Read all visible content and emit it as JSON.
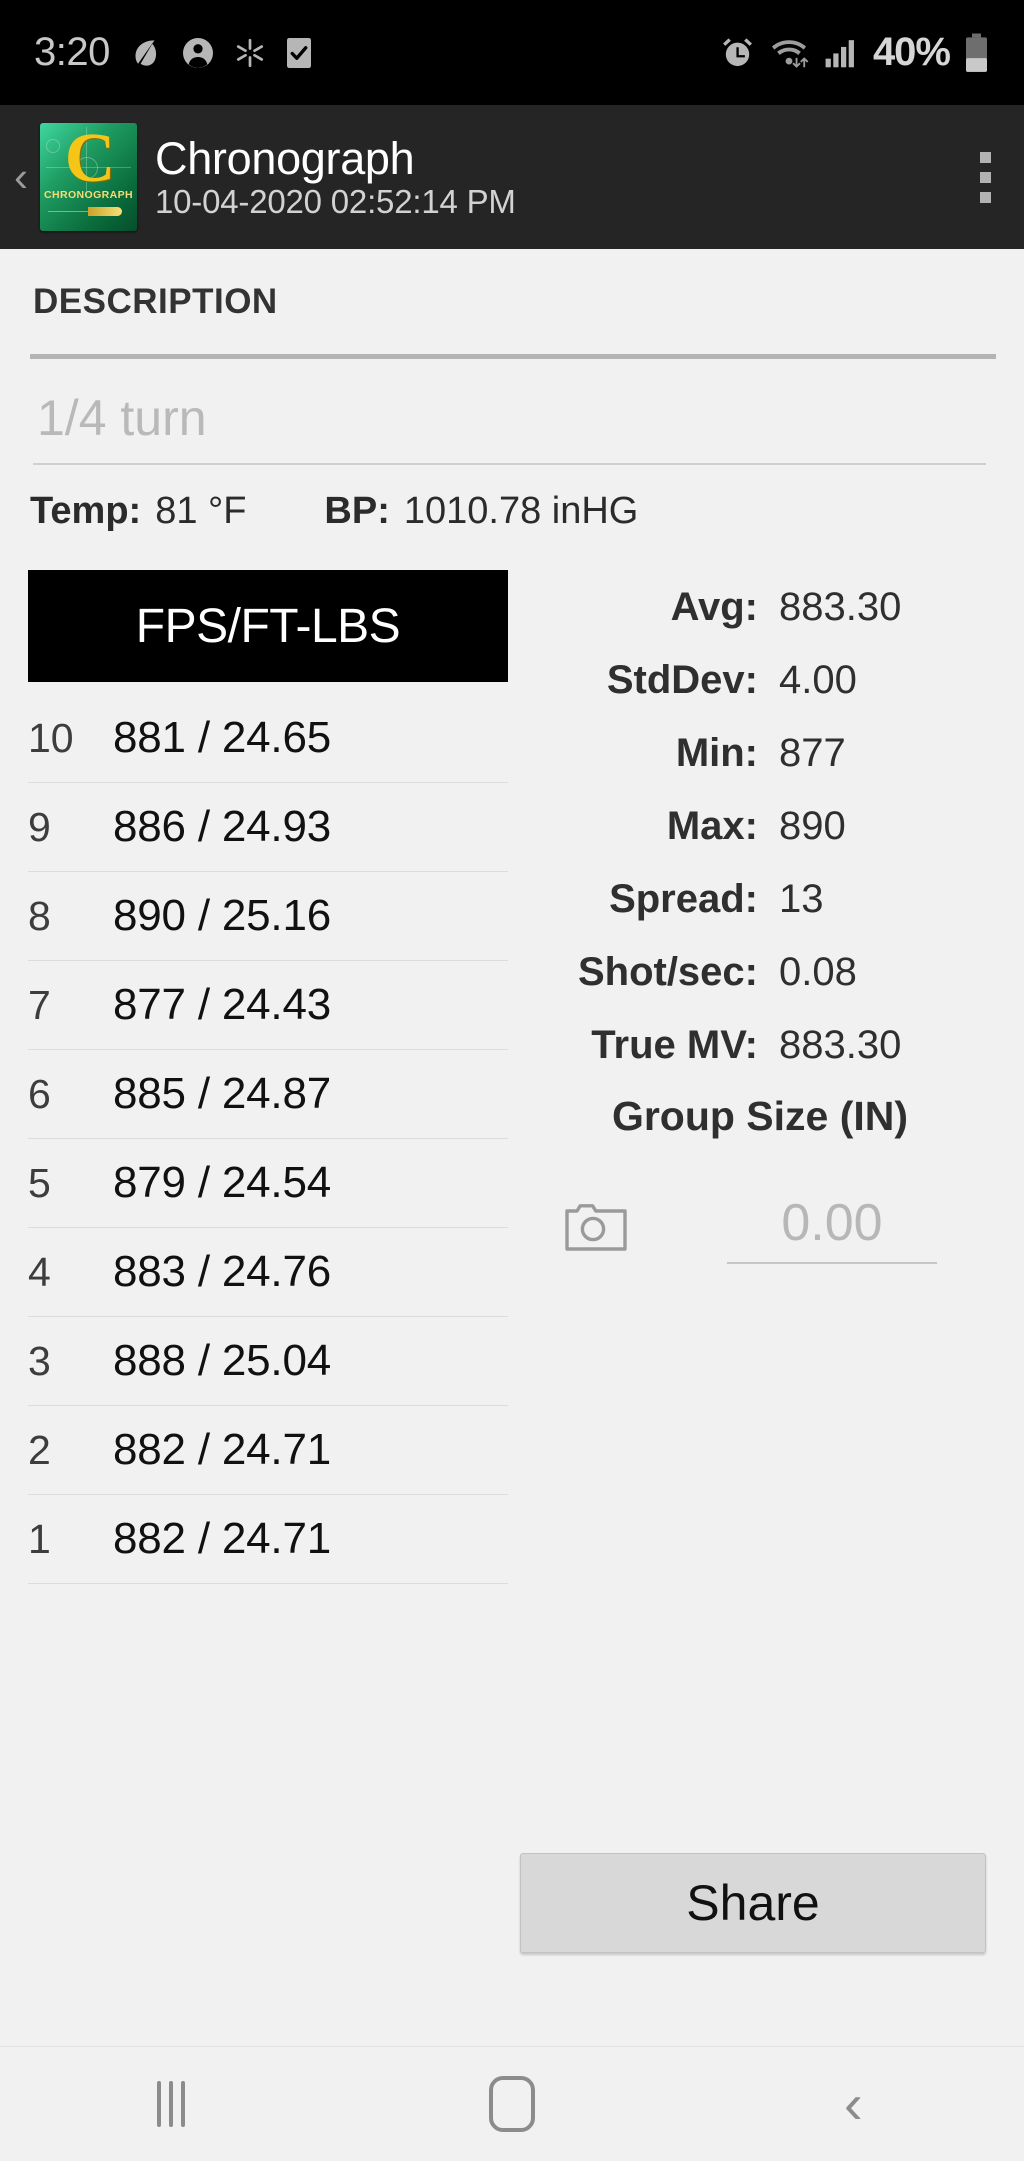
{
  "statusbar": {
    "clock": "3:20",
    "battery_percent": "40%",
    "icons": [
      "battery-saver-leaf-icon",
      "person-icon",
      "bluetooth-asterisk-icon",
      "task-checkbox-icon",
      "alarm-icon",
      "wifi-icon",
      "cellular-signal-icon",
      "battery-icon"
    ]
  },
  "appbar": {
    "back_glyph": "‹",
    "title": "Chronograph",
    "subtitle": "10-04-2020 02:52:14 PM",
    "logo_letter": "C",
    "logo_text": "CHRONOGRAPH",
    "overflow_label": "overflow-menu"
  },
  "description": {
    "label": "DESCRIPTION",
    "value": "",
    "placeholder": "1/4 turn"
  },
  "environment": {
    "temp_label": "Temp:",
    "temp_value": "81 °F",
    "bp_label": "BP:",
    "bp_value": "1010.78 inHG"
  },
  "table": {
    "header": "FPS/FT-LBS",
    "rows": [
      {
        "index": "10",
        "value": "881 / 24.65",
        "fps": 881,
        "ftlbs": 24.65
      },
      {
        "index": "9",
        "value": "886 / 24.93",
        "fps": 886,
        "ftlbs": 24.93
      },
      {
        "index": "8",
        "value": "890 / 25.16",
        "fps": 890,
        "ftlbs": 25.16
      },
      {
        "index": "7",
        "value": "877 / 24.43",
        "fps": 877,
        "ftlbs": 24.43
      },
      {
        "index": "6",
        "value": "885 / 24.87",
        "fps": 885,
        "ftlbs": 24.87
      },
      {
        "index": "5",
        "value": "879 / 24.54",
        "fps": 879,
        "ftlbs": 24.54
      },
      {
        "index": "4",
        "value": "883 / 24.76",
        "fps": 883,
        "ftlbs": 24.76
      },
      {
        "index": "3",
        "value": "888 / 25.04",
        "fps": 888,
        "ftlbs": 25.04
      },
      {
        "index": "2",
        "value": "882 / 24.71",
        "fps": 882,
        "ftlbs": 24.71
      },
      {
        "index": "1",
        "value": "882 / 24.71",
        "fps": 882,
        "ftlbs": 24.71
      }
    ]
  },
  "stats": [
    {
      "key": "Avg:",
      "value": "883.30"
    },
    {
      "key": "StdDev:",
      "value": "4.00"
    },
    {
      "key": "Min:",
      "value": "877"
    },
    {
      "key": "Max:",
      "value": "890"
    },
    {
      "key": "Spread:",
      "value": "13"
    },
    {
      "key": "Shot/sec:",
      "value": "0.08"
    },
    {
      "key": "True MV:",
      "value": "883.30"
    }
  ],
  "group_size": {
    "title": "Group Size (IN)",
    "value": "",
    "placeholder": "0.00",
    "camera_label": "camera-icon"
  },
  "actions": {
    "share_label": "Share"
  },
  "navbar": {
    "recents": "recents-button",
    "home": "home-button",
    "back_glyph": "‹"
  },
  "colors": {
    "appbar_bg": "#252525",
    "page_bg": "#f1f1f1",
    "header_black": "#000000",
    "button_bg": "#d8d8d8",
    "logo_green": "#1f9e63",
    "logo_gold": "#f5c518"
  }
}
